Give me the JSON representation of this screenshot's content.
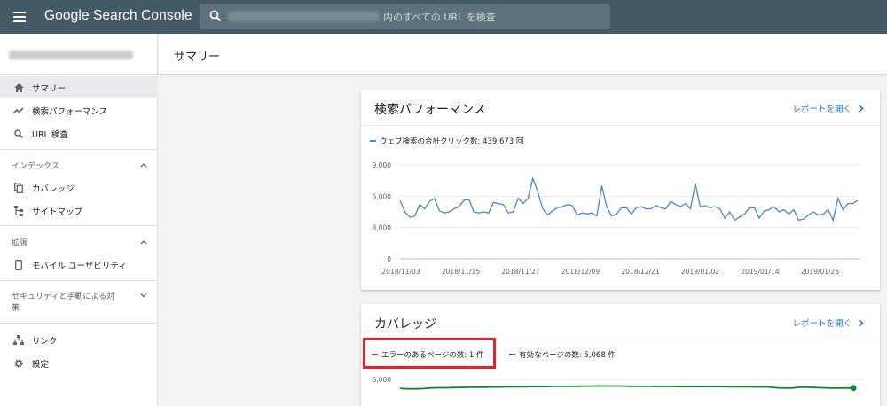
{
  "app": {
    "title": "Google Search Console"
  },
  "search": {
    "placeholder": "内のすべての URL を検査"
  },
  "sidebar": {
    "items": [
      {
        "label": "サマリー",
        "icon": "home-icon"
      },
      {
        "label": "検索パフォーマンス",
        "icon": "trending-icon"
      },
      {
        "label": "URL 検査",
        "icon": "search-icon"
      },
      {
        "label": "カバレッジ",
        "icon": "copy-icon"
      },
      {
        "label": "サイトマップ",
        "icon": "sitemap-icon"
      },
      {
        "label": "モバイル ユーザビリティ",
        "icon": "phone-icon"
      },
      {
        "label": "リンク",
        "icon": "links-icon"
      },
      {
        "label": "設定",
        "icon": "gear-icon"
      }
    ],
    "sections": {
      "index": "インデックス",
      "enhancements": "拡張",
      "security_line1": "セキュリティと手動による対",
      "security_line2": "策"
    }
  },
  "page": {
    "title": "サマリー"
  },
  "performance": {
    "title": "検索パフォーマンス",
    "link": "レポートを開く",
    "legend": "ウェブ検索の合計クリック数: 439,673 回"
  },
  "coverage": {
    "title": "カバレッジ",
    "link": "レポートを開く",
    "legend_error": "エラーのあるページの数: 1 件",
    "legend_valid": "有効なページの数: 5,068 件"
  },
  "colors": {
    "topbar": "#455a64",
    "link": "#1a73e8",
    "clicks": "#4a86c8",
    "error": "#d93025",
    "valid": "#188038",
    "highlight": "#e8202a"
  },
  "chart_data": [
    {
      "type": "line",
      "title": "",
      "series": [
        {
          "name": "ウェブ検索の合計クリック数: 439,673 回",
          "values": [
            5600,
            4500,
            4000,
            4100,
            5200,
            4800,
            5500,
            5800,
            4600,
            4400,
            4500,
            4800,
            5000,
            5600,
            5700,
            4500,
            4400,
            4500,
            4400,
            5400,
            5300,
            5200,
            4400,
            4500,
            5800,
            5300,
            5800,
            7700,
            6400,
            4800,
            4200,
            4600,
            4900,
            5000,
            5200,
            5100,
            4200,
            4400,
            4300,
            4400,
            4100,
            7000,
            5000,
            4100,
            4300,
            4900,
            4900,
            4300,
            4900,
            5000,
            4800,
            4800,
            5100,
            4900,
            4800,
            5500,
            5200,
            5000,
            5300,
            4800,
            7200,
            5000,
            5100,
            4900,
            5000,
            4800,
            3900,
            4500,
            3700,
            4000,
            4300,
            4900,
            4900,
            3900,
            4600,
            4700,
            5000,
            4500,
            4700,
            4300,
            4700,
            3700,
            3800,
            4200,
            4500,
            4200,
            4300,
            4700,
            3700,
            5800,
            4700,
            5300,
            5300,
            5600
          ]
        }
      ],
      "x_ticks": [
        "2018/11/03",
        "2018/11/15",
        "2018/11/27",
        "2018/12/09",
        "2018/12/21",
        "2019/01/02",
        "2019/01/14",
        "2019/01/26"
      ],
      "y_ticks": [
        "9,000",
        "6,000",
        "3,000",
        "0"
      ],
      "ylim": [
        0,
        9000
      ],
      "grid": true
    },
    {
      "type": "line",
      "title": "",
      "series": [
        {
          "name": "エラーのあるページの数: 1 件",
          "values": [
            1,
            1,
            1,
            1,
            1,
            1,
            1,
            1,
            1,
            1,
            1,
            1,
            1,
            1,
            1,
            1,
            1,
            1,
            1,
            1,
            1,
            1,
            1,
            1,
            1,
            1,
            1,
            1,
            1,
            1,
            1,
            1,
            1,
            1,
            1,
            1,
            1,
            1,
            1,
            1,
            1,
            1,
            1,
            1,
            1,
            1,
            1,
            1,
            1,
            1,
            1,
            1,
            1,
            1,
            1,
            1,
            1,
            1,
            1,
            1
          ]
        },
        {
          "name": "有効なページの数: 5,068 件",
          "values": [
            5030,
            4980,
            4980,
            5010,
            5080,
            5100,
            5100,
            5120,
            5120,
            5150,
            5160,
            5160,
            5180,
            5180,
            5200,
            5200,
            5200,
            5220,
            5230,
            5230,
            5250,
            5250,
            5260,
            5260,
            5280,
            5280,
            5300,
            5290,
            5290,
            5280,
            5260,
            5260,
            5250,
            5250,
            5240,
            5240,
            5230,
            5230,
            5220,
            5230,
            5230,
            5220,
            5220,
            5200,
            5200,
            5200,
            5190,
            5190,
            5180,
            5100,
            5060,
            5070,
            5150,
            5150,
            5120,
            5100,
            5060,
            5060,
            5070,
            5068
          ]
        }
      ],
      "y_ticks": [
        "6,000"
      ],
      "grid": true
    }
  ]
}
